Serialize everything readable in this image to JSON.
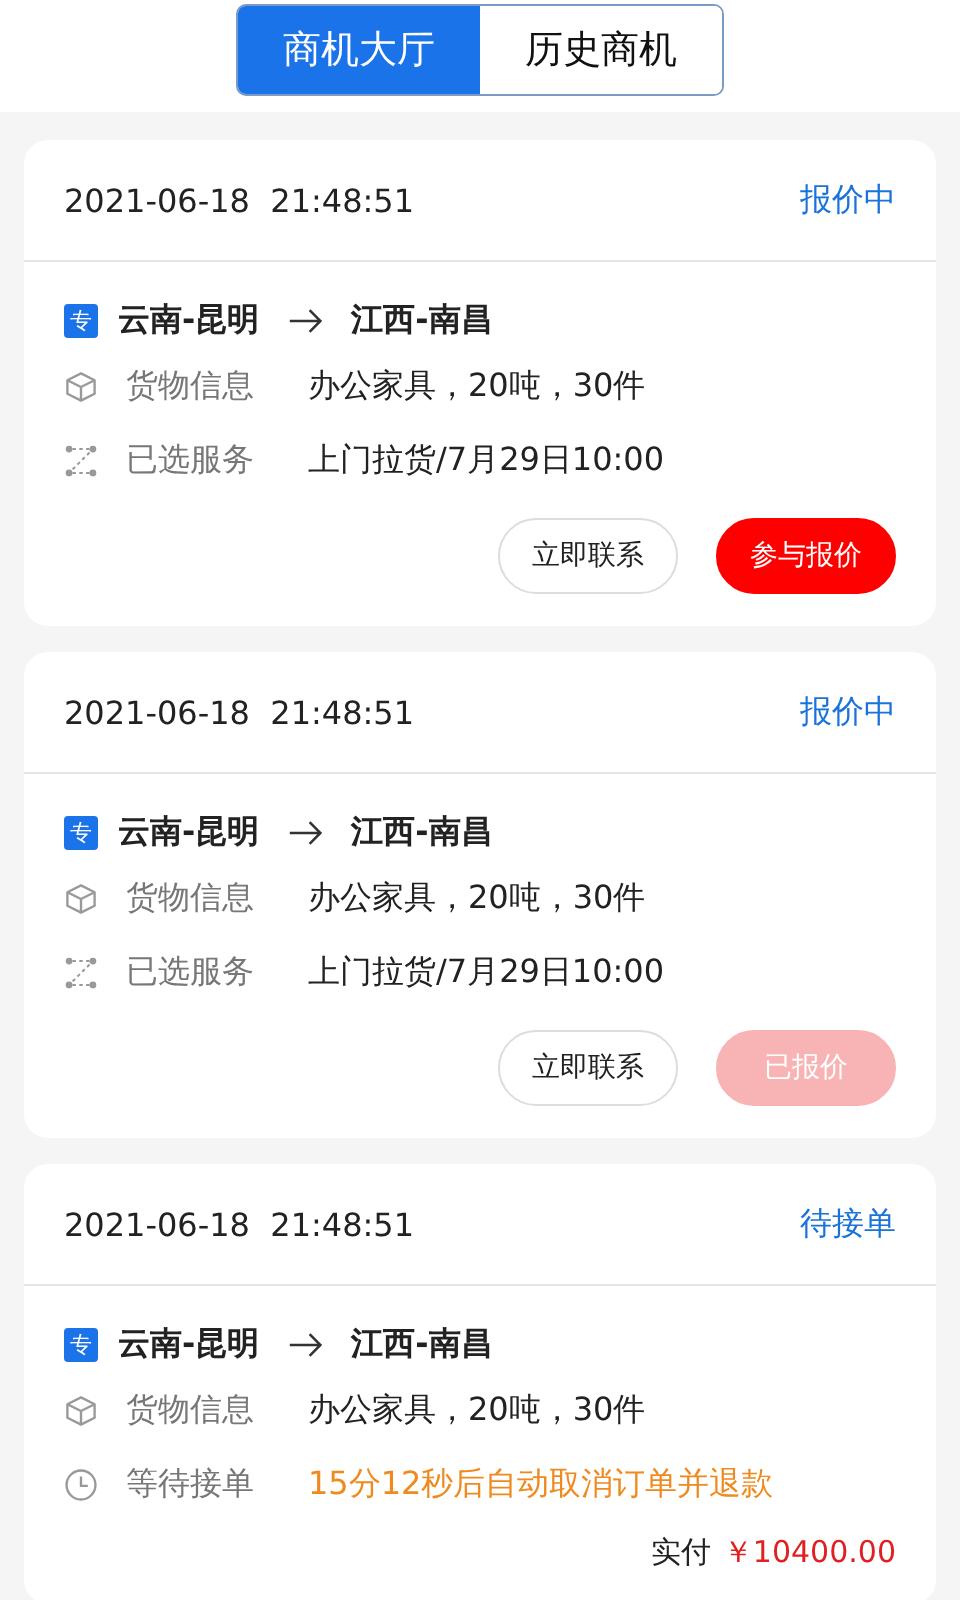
{
  "tabs": [
    {
      "label": "商机大厅",
      "selected": true
    },
    {
      "label": "历史商机",
      "selected": false
    }
  ],
  "cards": [
    {
      "time": "2021-06-18  21:48:51",
      "status": "报价中",
      "badge": "专",
      "from": "云南-昆明",
      "to": "江西-南昌",
      "rows": [
        {
          "kind": "cargo",
          "label": "货物信息",
          "value": "办公家具，20吨，30件"
        },
        {
          "kind": "service",
          "label": "已选服务",
          "value": "上门拉货/7月29日10:00"
        }
      ],
      "buttons": [
        {
          "kind": "outline",
          "label": "立即联系",
          "disabled": false
        },
        {
          "kind": "primary",
          "label": "参与报价",
          "disabled": false
        }
      ]
    },
    {
      "time": "2021-06-18  21:48:51",
      "status": "报价中",
      "badge": "专",
      "from": "云南-昆明",
      "to": "江西-南昌",
      "rows": [
        {
          "kind": "cargo",
          "label": "货物信息",
          "value": "办公家具，20吨，30件"
        },
        {
          "kind": "service",
          "label": "已选服务",
          "value": "上门拉货/7月29日10:00"
        }
      ],
      "buttons": [
        {
          "kind": "outline",
          "label": "立即联系",
          "disabled": false
        },
        {
          "kind": "primary",
          "label": "已报价",
          "disabled": true
        }
      ]
    },
    {
      "time": "2021-06-18  21:48:51",
      "status": "待接单",
      "badge": "专",
      "from": "云南-昆明",
      "to": "江西-南昌",
      "rows": [
        {
          "kind": "cargo",
          "label": "货物信息",
          "value": "办公家具，20吨，30件"
        },
        {
          "kind": "waiting",
          "label": "等待接单",
          "value": "15分12秒后自动取消订单并退款"
        }
      ],
      "paid": {
        "label": "实付",
        "amount": "￥10400.00"
      }
    }
  ]
}
